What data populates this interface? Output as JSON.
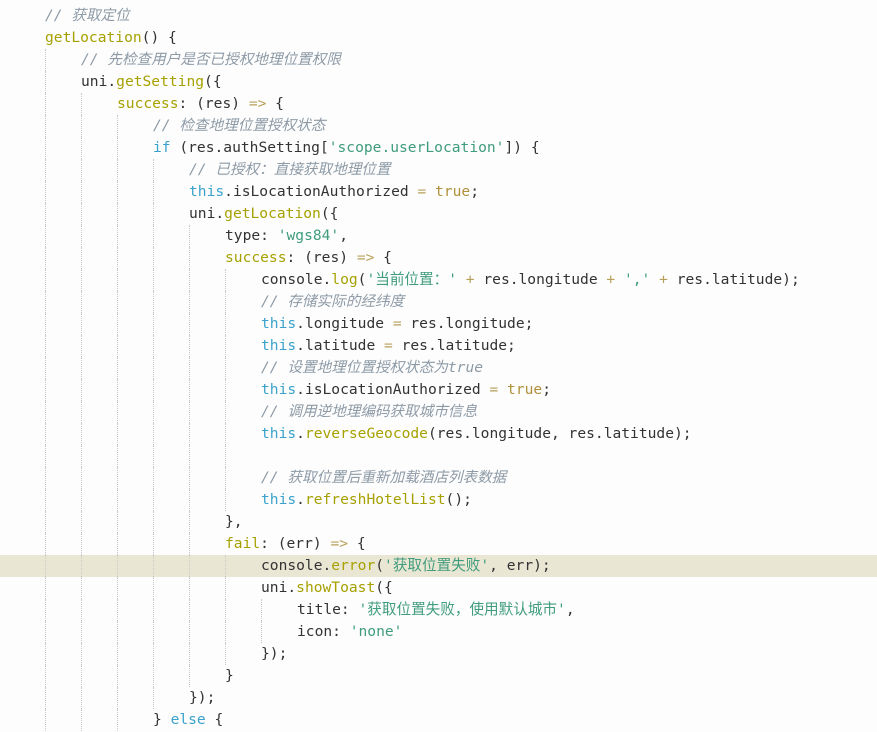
{
  "colors": {
    "background": "#fdfdfd",
    "current_line_highlight": "#e9e6d4",
    "comment": "#8d9aa6",
    "function": "#a6a100",
    "keyword": "#3aa2cc",
    "string": "#3f9c7c",
    "operator": "#b8a05a",
    "plain": "#333333",
    "boolean": "#b0913b"
  },
  "editor": {
    "highlighted_line": 25,
    "lines": [
      {
        "indent": 1,
        "tokens": [
          {
            "t": "comment",
            "v": "// 获取定位"
          }
        ]
      },
      {
        "indent": 1,
        "tokens": [
          {
            "t": "fn",
            "v": "getLocation"
          },
          {
            "t": "plain",
            "v": "() {"
          }
        ]
      },
      {
        "indent": 2,
        "tokens": [
          {
            "t": "comment",
            "v": "// 先检查用户是否已授权地理位置权限"
          }
        ]
      },
      {
        "indent": 2,
        "tokens": [
          {
            "t": "plain",
            "v": "uni."
          },
          {
            "t": "fn",
            "v": "getSetting"
          },
          {
            "t": "plain",
            "v": "({"
          }
        ]
      },
      {
        "indent": 3,
        "tokens": [
          {
            "t": "fn",
            "v": "success"
          },
          {
            "t": "plain",
            "v": ": (res) "
          },
          {
            "t": "op",
            "v": "=>"
          },
          {
            "t": "plain",
            "v": " {"
          }
        ]
      },
      {
        "indent": 4,
        "tokens": [
          {
            "t": "comment",
            "v": "// 检查地理位置授权状态"
          }
        ]
      },
      {
        "indent": 4,
        "tokens": [
          {
            "t": "kw",
            "v": "if"
          },
          {
            "t": "plain",
            "v": " (res.authSetting["
          },
          {
            "t": "str",
            "v": "'scope.userLocation'"
          },
          {
            "t": "plain",
            "v": "]) {"
          }
        ]
      },
      {
        "indent": 5,
        "tokens": [
          {
            "t": "comment",
            "v": "// 已授权：直接获取地理位置"
          }
        ]
      },
      {
        "indent": 5,
        "tokens": [
          {
            "t": "kw",
            "v": "this"
          },
          {
            "t": "plain",
            "v": ".isLocationAuthorized "
          },
          {
            "t": "op",
            "v": "="
          },
          {
            "t": "plain",
            "v": " "
          },
          {
            "t": "bool",
            "v": "true"
          },
          {
            "t": "plain",
            "v": ";"
          }
        ]
      },
      {
        "indent": 5,
        "tokens": [
          {
            "t": "plain",
            "v": "uni."
          },
          {
            "t": "fn",
            "v": "getLocation"
          },
          {
            "t": "plain",
            "v": "({"
          }
        ]
      },
      {
        "indent": 6,
        "tokens": [
          {
            "t": "plain",
            "v": "type: "
          },
          {
            "t": "str",
            "v": "'wgs84'"
          },
          {
            "t": "plain",
            "v": ","
          }
        ]
      },
      {
        "indent": 6,
        "tokens": [
          {
            "t": "fn",
            "v": "success"
          },
          {
            "t": "plain",
            "v": ": (res) "
          },
          {
            "t": "op",
            "v": "=>"
          },
          {
            "t": "plain",
            "v": " {"
          }
        ]
      },
      {
        "indent": 7,
        "tokens": [
          {
            "t": "plain",
            "v": "console."
          },
          {
            "t": "fn",
            "v": "log"
          },
          {
            "t": "plain",
            "v": "("
          },
          {
            "t": "str",
            "v": "'当前位置：'"
          },
          {
            "t": "plain",
            "v": " "
          },
          {
            "t": "op",
            "v": "+"
          },
          {
            "t": "plain",
            "v": " res.longitude "
          },
          {
            "t": "op",
            "v": "+"
          },
          {
            "t": "plain",
            "v": " "
          },
          {
            "t": "str",
            "v": "','"
          },
          {
            "t": "plain",
            "v": " "
          },
          {
            "t": "op",
            "v": "+"
          },
          {
            "t": "plain",
            "v": " res.latitude);"
          }
        ]
      },
      {
        "indent": 7,
        "tokens": [
          {
            "t": "comment",
            "v": "// 存储实际的经纬度"
          }
        ]
      },
      {
        "indent": 7,
        "tokens": [
          {
            "t": "kw",
            "v": "this"
          },
          {
            "t": "plain",
            "v": ".longitude "
          },
          {
            "t": "op",
            "v": "="
          },
          {
            "t": "plain",
            "v": " res.longitude;"
          }
        ]
      },
      {
        "indent": 7,
        "tokens": [
          {
            "t": "kw",
            "v": "this"
          },
          {
            "t": "plain",
            "v": ".latitude "
          },
          {
            "t": "op",
            "v": "="
          },
          {
            "t": "plain",
            "v": " res.latitude;"
          }
        ]
      },
      {
        "indent": 7,
        "tokens": [
          {
            "t": "comment",
            "v": "// 设置地理位置授权状态为true"
          }
        ]
      },
      {
        "indent": 7,
        "tokens": [
          {
            "t": "kw",
            "v": "this"
          },
          {
            "t": "plain",
            "v": ".isLocationAuthorized "
          },
          {
            "t": "op",
            "v": "="
          },
          {
            "t": "plain",
            "v": " "
          },
          {
            "t": "bool",
            "v": "true"
          },
          {
            "t": "plain",
            "v": ";"
          }
        ]
      },
      {
        "indent": 7,
        "tokens": [
          {
            "t": "comment",
            "v": "// 调用逆地理编码获取城市信息"
          }
        ]
      },
      {
        "indent": 7,
        "tokens": [
          {
            "t": "kw",
            "v": "this"
          },
          {
            "t": "plain",
            "v": "."
          },
          {
            "t": "fn",
            "v": "reverseGeocode"
          },
          {
            "t": "plain",
            "v": "(res.longitude, res.latitude);"
          }
        ]
      },
      {
        "indent": 7,
        "tokens": []
      },
      {
        "indent": 7,
        "tokens": [
          {
            "t": "comment",
            "v": "// 获取位置后重新加载酒店列表数据"
          }
        ]
      },
      {
        "indent": 7,
        "tokens": [
          {
            "t": "kw",
            "v": "this"
          },
          {
            "t": "plain",
            "v": "."
          },
          {
            "t": "fn",
            "v": "refreshHotelList"
          },
          {
            "t": "plain",
            "v": "();"
          }
        ]
      },
      {
        "indent": 6,
        "tokens": [
          {
            "t": "plain",
            "v": "},"
          }
        ]
      },
      {
        "indent": 6,
        "tokens": [
          {
            "t": "fn",
            "v": "fail"
          },
          {
            "t": "plain",
            "v": ": (err) "
          },
          {
            "t": "op",
            "v": "=>"
          },
          {
            "t": "plain",
            "v": " {"
          }
        ]
      },
      {
        "indent": 7,
        "tokens": [
          {
            "t": "plain",
            "v": "console."
          },
          {
            "t": "fn",
            "v": "error"
          },
          {
            "t": "plain",
            "v": "("
          },
          {
            "t": "str",
            "v": "'获取位置失败'"
          },
          {
            "t": "plain",
            "v": ", err);"
          }
        ]
      },
      {
        "indent": 7,
        "tokens": [
          {
            "t": "plain",
            "v": "uni."
          },
          {
            "t": "fn",
            "v": "showToast"
          },
          {
            "t": "plain",
            "v": "({"
          }
        ]
      },
      {
        "indent": 8,
        "tokens": [
          {
            "t": "plain",
            "v": "title: "
          },
          {
            "t": "str",
            "v": "'获取位置失败，使用默认城市'"
          },
          {
            "t": "plain",
            "v": ","
          }
        ]
      },
      {
        "indent": 8,
        "tokens": [
          {
            "t": "plain",
            "v": "icon: "
          },
          {
            "t": "str",
            "v": "'none'"
          }
        ]
      },
      {
        "indent": 7,
        "tokens": [
          {
            "t": "plain",
            "v": "});"
          }
        ]
      },
      {
        "indent": 6,
        "tokens": [
          {
            "t": "plain",
            "v": "}"
          }
        ]
      },
      {
        "indent": 5,
        "tokens": [
          {
            "t": "plain",
            "v": "});"
          }
        ]
      },
      {
        "indent": 4,
        "tokens": [
          {
            "t": "plain",
            "v": "} "
          },
          {
            "t": "kw",
            "v": "else"
          },
          {
            "t": "plain",
            "v": " {"
          }
        ]
      }
    ]
  }
}
